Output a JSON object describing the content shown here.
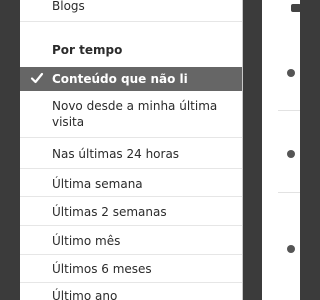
{
  "sidebar": {
    "top_item": "Blogs",
    "section_heading": "Por tempo",
    "items": [
      {
        "label": "Conteúdo que não li",
        "selected": true
      },
      {
        "label": "Novo desde a minha última visita",
        "selected": false
      },
      {
        "label": "Nas últimas 24 horas",
        "selected": false
      },
      {
        "label": "Última semana",
        "selected": false
      },
      {
        "label": "Últimas 2 semanas",
        "selected": false
      },
      {
        "label": "Último mês",
        "selected": false
      },
      {
        "label": "Últimos 6 meses",
        "selected": false
      },
      {
        "label": "Último ano",
        "selected": false
      }
    ],
    "selected_bg": "#666666"
  },
  "content": {
    "bullet_icon": "bullet-icon",
    "corner_icon": "chat-icon"
  }
}
